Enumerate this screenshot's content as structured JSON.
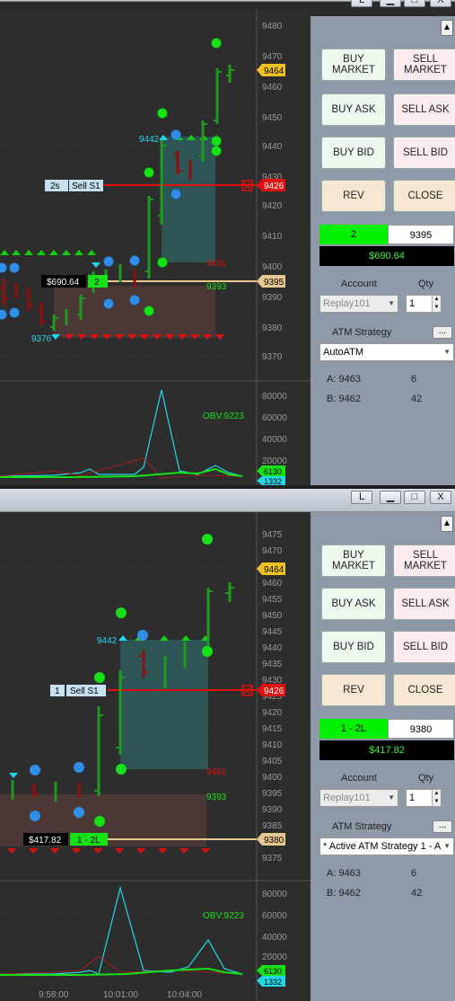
{
  "window_buttons": {
    "restore": "L",
    "minimize": "—",
    "maximize": "□",
    "close": "X"
  },
  "top": {
    "price_axis": [
      "9480",
      "9470",
      "9460",
      "9450",
      "9440",
      "9430",
      "9420",
      "9410",
      "9400",
      "9390",
      "9380",
      "9370"
    ],
    "indicator_axis": [
      "80000",
      "60000",
      "40000",
      "20000"
    ],
    "tags": {
      "last": "9464",
      "stop": "9426",
      "position": "9395",
      "obv_a": "6130",
      "obv_b": "1332"
    },
    "labels": {
      "high": "9442",
      "low": "9376",
      "level_red": "9401",
      "level_green": "9393",
      "obv": "OBV:9223"
    },
    "order_label": {
      "qty": "2s",
      "name": "Sell S1"
    },
    "pnl_label": {
      "pnl": "$690.64",
      "qty": "2"
    },
    "panel": {
      "buy_market": "BUY MARKET",
      "sell_market": "SELL MARKET",
      "buy_ask": "BUY ASK",
      "sell_ask": "SELL ASK",
      "buy_bid": "BUY BID",
      "sell_bid": "SELL BID",
      "rev": "REV",
      "close": "CLOSE",
      "position_qty": "2",
      "position_price": "9395",
      "pnl": "$690.64",
      "account_label": "Account",
      "qty_label": "Qty",
      "account": "Replay101",
      "qty": "1",
      "atm_label": "ATM Strategy",
      "atm_dots": "...",
      "atm_value": "AutoATM",
      "a_label": "A: 9463",
      "a_val": "6",
      "b_label": "B: 9462",
      "b_val": "42"
    }
  },
  "bottom": {
    "price_axis": [
      "9475",
      "9470",
      "9465",
      "9460",
      "9455",
      "9450",
      "9445",
      "9440",
      "9435",
      "9430",
      "9425",
      "9420",
      "9415",
      "9410",
      "9405",
      "9400",
      "9395",
      "9390",
      "9385",
      "9380",
      "9375"
    ],
    "indicator_axis": [
      "80000",
      "60000",
      "40000",
      "20000"
    ],
    "time_axis": [
      "9:58:00",
      "10:01:00",
      "10:04:00"
    ],
    "tags": {
      "last": "9464",
      "stop": "9426",
      "position": "9380",
      "obv_a": "6130",
      "obv_b": "1332"
    },
    "labels": {
      "high": "9442",
      "level_red": "9401",
      "level_green": "9393",
      "obv": "OBV:9223"
    },
    "order_label": {
      "qty": "1",
      "name": "Sell S1"
    },
    "pnl_label": {
      "pnl": "$417.82",
      "qty": "1 - 2L"
    },
    "panel": {
      "buy_market": "BUY MARKET",
      "sell_market": "SELL MARKET",
      "buy_ask": "BUY ASK",
      "sell_ask": "SELL ASK",
      "buy_bid": "BUY BID",
      "sell_bid": "SELL BID",
      "rev": "REV",
      "close": "CLOSE",
      "position_qty": "1 - 2L",
      "position_price": "9380",
      "pnl": "$417.82",
      "account_label": "Account",
      "qty_label": "Qty",
      "account": "Replay101",
      "qty": "1",
      "atm_label": "ATM Strategy",
      "atm_dots": "...",
      "atm_value": "* Active ATM Strategy 1 - A",
      "a_label": "A: 9463",
      "a_val": "6",
      "b_label": "B: 9462",
      "b_val": "42"
    }
  },
  "colors": {
    "up_bar": "#1e9a1e",
    "down_bar": "#8b1010",
    "stop_line": "#e01010",
    "position_line": "#e8c890",
    "zone_green": "#2f6b6b",
    "zone_red": "#5a3a3a",
    "cyan": "#22d8e8"
  }
}
